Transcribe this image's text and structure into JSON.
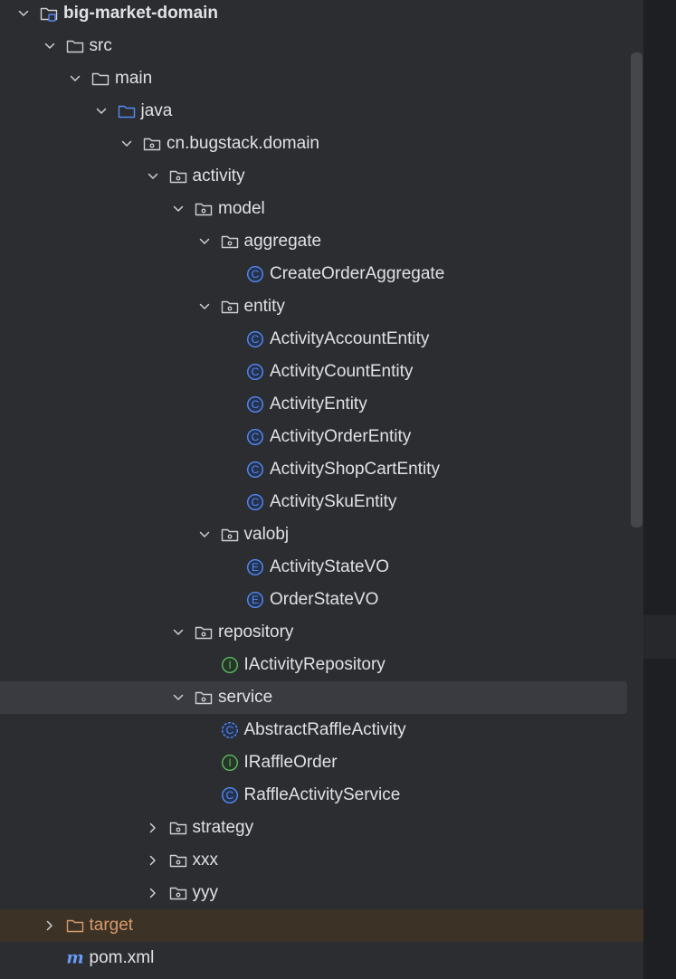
{
  "project_tree": {
    "rows": [
      {
        "label": "big-market-domain",
        "icon": "module-folder-icon",
        "arrow": "chevron-down-icon",
        "depth": 0,
        "bold": true
      },
      {
        "label": "src",
        "icon": "folder-icon",
        "arrow": "chevron-down-icon",
        "depth": 1
      },
      {
        "label": "main",
        "icon": "folder-icon",
        "arrow": "chevron-down-icon",
        "depth": 2
      },
      {
        "label": "java",
        "icon": "source-root-folder-icon",
        "arrow": "chevron-down-icon",
        "depth": 3
      },
      {
        "label": "cn.bugstack.domain",
        "icon": "package-icon",
        "arrow": "chevron-down-icon",
        "depth": 4
      },
      {
        "label": "activity",
        "icon": "package-icon",
        "arrow": "chevron-down-icon",
        "depth": 5
      },
      {
        "label": "model",
        "icon": "package-icon",
        "arrow": "chevron-down-icon",
        "depth": 6
      },
      {
        "label": "aggregate",
        "icon": "package-icon",
        "arrow": "chevron-down-icon",
        "depth": 7
      },
      {
        "label": "CreateOrderAggregate",
        "icon": "class-icon",
        "arrow": "",
        "depth": 8
      },
      {
        "label": "entity",
        "icon": "package-icon",
        "arrow": "chevron-down-icon",
        "depth": 7
      },
      {
        "label": "ActivityAccountEntity",
        "icon": "class-icon",
        "arrow": "",
        "depth": 8
      },
      {
        "label": "ActivityCountEntity",
        "icon": "class-icon",
        "arrow": "",
        "depth": 8
      },
      {
        "label": "ActivityEntity",
        "icon": "class-icon",
        "arrow": "",
        "depth": 8
      },
      {
        "label": "ActivityOrderEntity",
        "icon": "class-icon",
        "arrow": "",
        "depth": 8
      },
      {
        "label": "ActivityShopCartEntity",
        "icon": "class-icon",
        "arrow": "",
        "depth": 8
      },
      {
        "label": "ActivitySkuEntity",
        "icon": "class-icon",
        "arrow": "",
        "depth": 8
      },
      {
        "label": "valobj",
        "icon": "package-icon",
        "arrow": "chevron-down-icon",
        "depth": 7
      },
      {
        "label": "ActivityStateVO",
        "icon": "enum-icon",
        "arrow": "",
        "depth": 8
      },
      {
        "label": "OrderStateVO",
        "icon": "enum-icon",
        "arrow": "",
        "depth": 8
      },
      {
        "label": "repository",
        "icon": "package-icon",
        "arrow": "chevron-down-icon",
        "depth": 6
      },
      {
        "label": "IActivityRepository",
        "icon": "interface-icon",
        "arrow": "",
        "depth": 7
      },
      {
        "label": "service",
        "icon": "package-icon",
        "arrow": "chevron-down-icon",
        "depth": 6,
        "selected": true
      },
      {
        "label": "AbstractRaffleActivity",
        "icon": "abstract-class-icon",
        "arrow": "",
        "depth": 7
      },
      {
        "label": "IRaffleOrder",
        "icon": "interface-icon",
        "arrow": "",
        "depth": 7
      },
      {
        "label": "RaffleActivityService",
        "icon": "class-icon",
        "arrow": "",
        "depth": 7
      },
      {
        "label": "strategy",
        "icon": "package-icon",
        "arrow": "chevron-right-icon",
        "depth": 5
      },
      {
        "label": "xxx",
        "icon": "package-icon",
        "arrow": "chevron-right-icon",
        "depth": 5
      },
      {
        "label": "yyy",
        "icon": "package-icon",
        "arrow": "chevron-right-icon",
        "depth": 5
      },
      {
        "label": "target",
        "icon": "excluded-folder-icon",
        "arrow": "chevron-right-icon",
        "depth": 1,
        "excluded": true
      },
      {
        "label": "pom.xml",
        "icon": "maven-icon",
        "arrow": "",
        "depth": 1
      }
    ]
  },
  "colors": {
    "background": "#2b2d30",
    "selection": "#393b40",
    "excluded_bg": "#3c3226",
    "text": "#dfe1e5",
    "excluded_text": "#d99a6b",
    "class_blue": "#548af7",
    "interface_green": "#5fb865",
    "maven_blue": "#6b9bfa"
  }
}
